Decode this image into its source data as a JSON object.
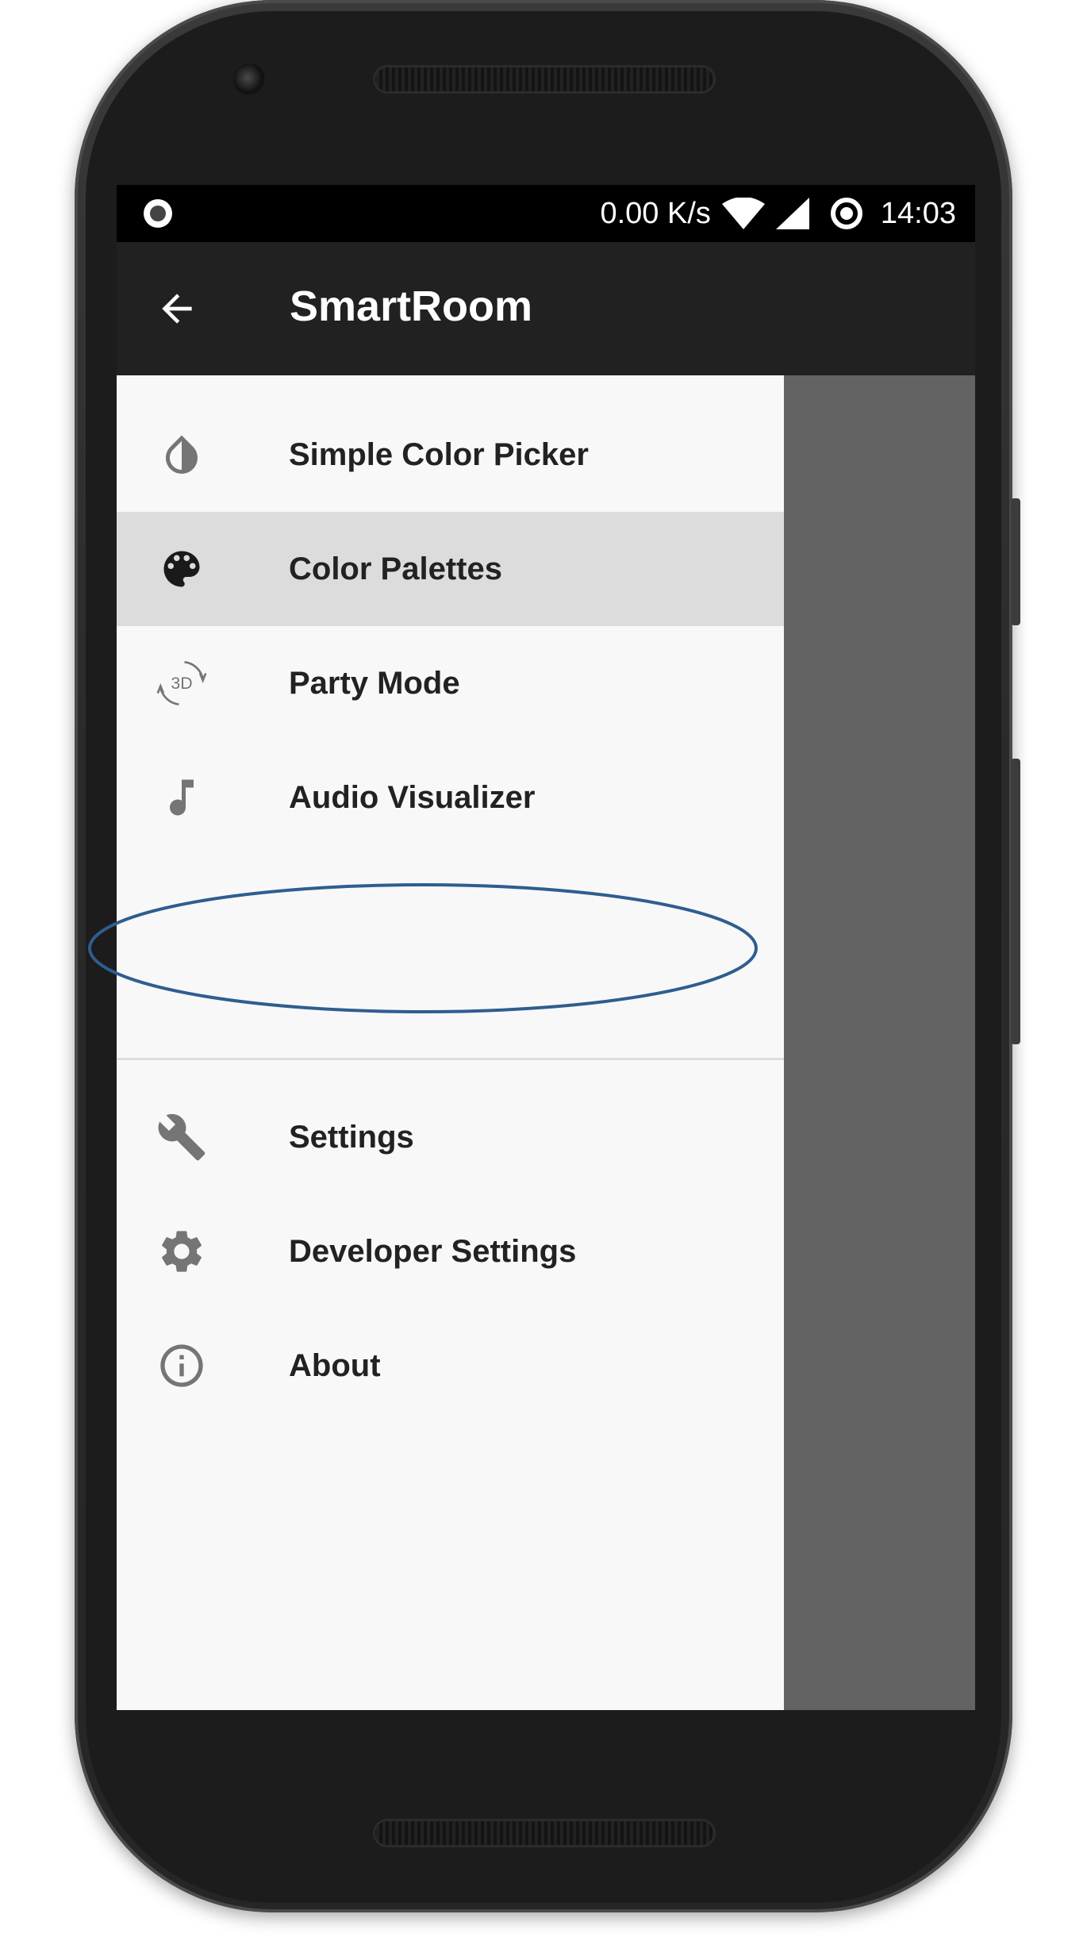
{
  "status_bar": {
    "notification_icon": "record-icon",
    "network_speed": "0.00 K/s",
    "wifi_icon": "wifi-icon",
    "signal_icon": "cell-signal-icon",
    "sync_icon": "sync-ring-icon",
    "time": "14:03"
  },
  "app_bar": {
    "back_icon": "arrow-back-icon",
    "title": "SmartRoom"
  },
  "drawer": {
    "items": [
      {
        "label": "Simple Color Picker",
        "icon": "drop-icon"
      },
      {
        "label": "Color Palettes",
        "icon": "palette-icon",
        "selected": true
      },
      {
        "label": "Party Mode",
        "icon": "3d-rotation-icon"
      },
      {
        "label": "Audio Visualizer",
        "icon": "music-note-icon"
      }
    ],
    "secondary_items": [
      {
        "label": "Settings",
        "icon": "wrench-icon",
        "annotated": true
      },
      {
        "label": "Developer Settings",
        "icon": "gear-icon"
      },
      {
        "label": "About",
        "icon": "info-icon"
      }
    ]
  },
  "colors": {
    "status_bar": "#000000",
    "app_bar": "#212121",
    "drawer_background": "#f8f8f8",
    "selected_item": "#dcdcdc",
    "scrim": "#636363",
    "icon": "#757575",
    "annotation_ellipse": "#2f5d8f"
  }
}
